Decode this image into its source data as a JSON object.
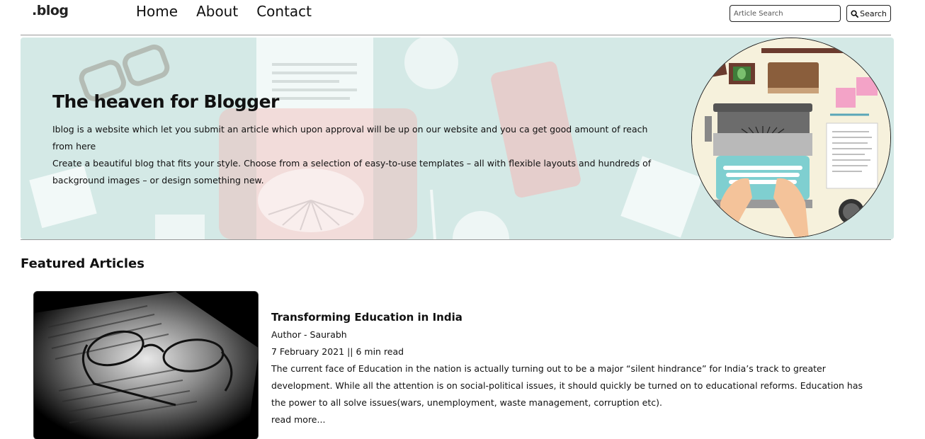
{
  "navbar": {
    "logo": ".blog",
    "links": [
      "Home",
      "About",
      "Contact"
    ],
    "search_placeholder": "Article Search",
    "search_button": "Search"
  },
  "hero": {
    "title": "The heaven for Blogger",
    "line1": "Iblog is a website which let you submit an article which upon approval will be up on our website and you ca get good amount of reach from here",
    "line2": "Create a beautiful blog that fits your style. Choose from a selection of easy-to-use templates – all with flexible layouts and hundreds of background images – or design something new."
  },
  "featured": {
    "heading": "Featured Articles",
    "article": {
      "title": "Transforming Education in India",
      "author": "Author - Saurabh",
      "meta": "7 February 2021 || 6 min read",
      "excerpt": "The current face of Education in the nation is actually turning out to be a major “silent hindrance” for India’s track to greater development. While all the attention is on social-political issues, it should quickly be turned on to educational reforms. Education has the power to all solve issues(wars, unemployment, waste management, corruption etc).",
      "read_more": "read more..."
    }
  },
  "colors": {
    "hero_bg": "#d4e9e6",
    "logo_accent": "#3a8a7a",
    "divider": "#999999"
  },
  "icons": [
    "search-icon"
  ]
}
